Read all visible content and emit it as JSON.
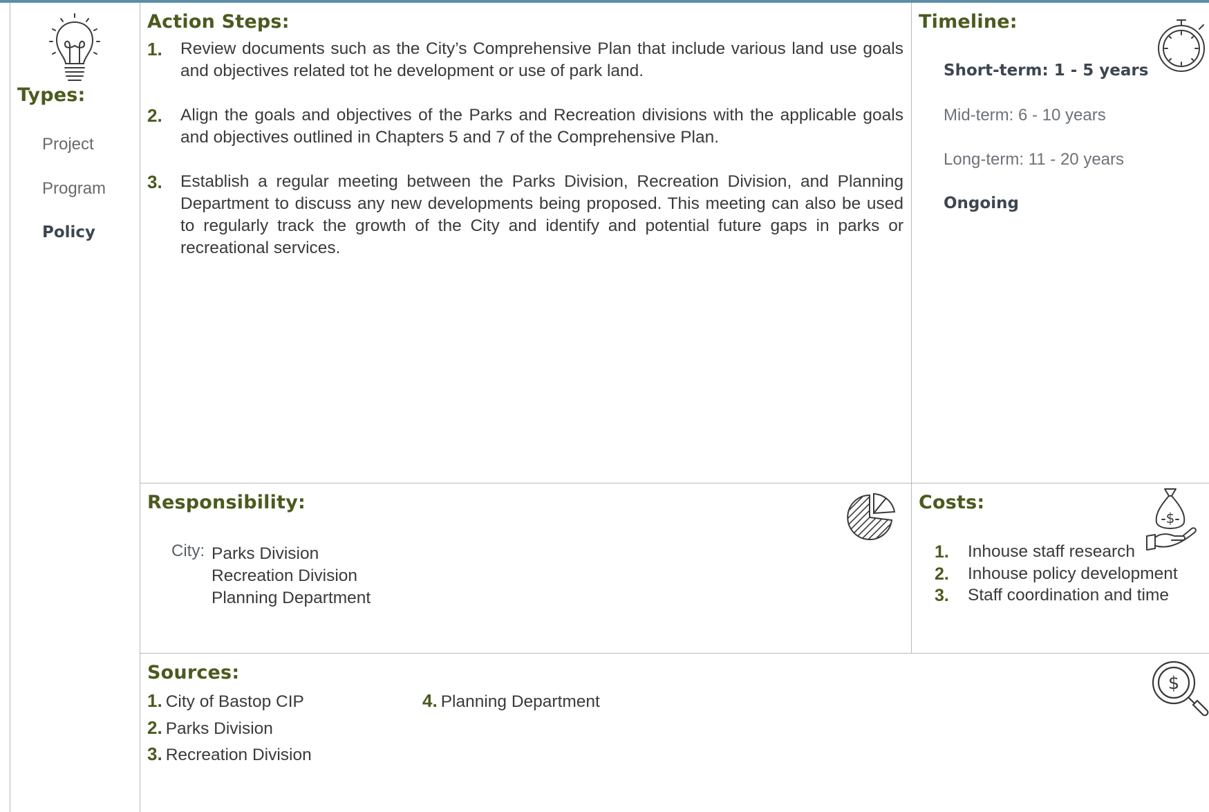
{
  "types": {
    "heading": "Types:",
    "items": [
      {
        "label": "Project",
        "active": false
      },
      {
        "label": "Program",
        "active": false
      },
      {
        "label": "Policy",
        "active": true
      }
    ],
    "icon": "lightbulb-icon"
  },
  "action_steps": {
    "heading": "Action Steps:",
    "steps": [
      {
        "number": "1.",
        "text": "Review documents such as the City’s Comprehensive Plan that include various land use goals and objectives related tot he development or use of park land."
      },
      {
        "number": "2.",
        "text": "Align the goals and objectives of the Parks and Recreation divisions with the applicable goals and objectives outlined in Chapters 5 and 7 of the Comprehensive Plan."
      },
      {
        "number": "3.",
        "text": "Establish a regular meeting between the Parks Division, Recreation Division, and Planning Department to discuss any new developments being proposed. This meeting can also be used to regularly track the growth of the City and identify and potential future gaps in parks or recreational services."
      }
    ]
  },
  "timeline": {
    "heading": "Timeline:",
    "icon": "stopwatch-icon",
    "items": [
      {
        "label": "Short-term:  1 - 5 years",
        "selected": true
      },
      {
        "label": "Mid-term:  6 - 10 years",
        "selected": false
      },
      {
        "label": "Long-term:  11 - 20 years",
        "selected": false
      },
      {
        "label": "Ongoing",
        "selected": true
      }
    ]
  },
  "responsibility": {
    "heading": "Responsibility:",
    "icon": "pie-chart-icon",
    "label": "City:",
    "items": [
      "Parks Division",
      "Recreation Division",
      "Planning Department"
    ]
  },
  "costs": {
    "heading": "Costs:",
    "icon": "money-bag-hand-icon",
    "items": [
      {
        "number": "1.",
        "text": "Inhouse staff research"
      },
      {
        "number": "2.",
        "text": "Inhouse policy development"
      },
      {
        "number": "3.",
        "text": "Staff coordination and time"
      }
    ]
  },
  "sources": {
    "heading": "Sources:",
    "icon": "search-dollar-icon",
    "items": [
      {
        "number": "1.",
        "text": "City of Bastop CIP"
      },
      {
        "number": "2.",
        "text": "Parks Division"
      },
      {
        "number": "3.",
        "text": "Recreation Division"
      },
      {
        "number": "4.",
        "text": "Planning Department"
      }
    ]
  },
  "colors": {
    "heading_green": "#4b5a1e",
    "top_bar": "#5b8fa8",
    "divider": "#b9b9b9"
  }
}
